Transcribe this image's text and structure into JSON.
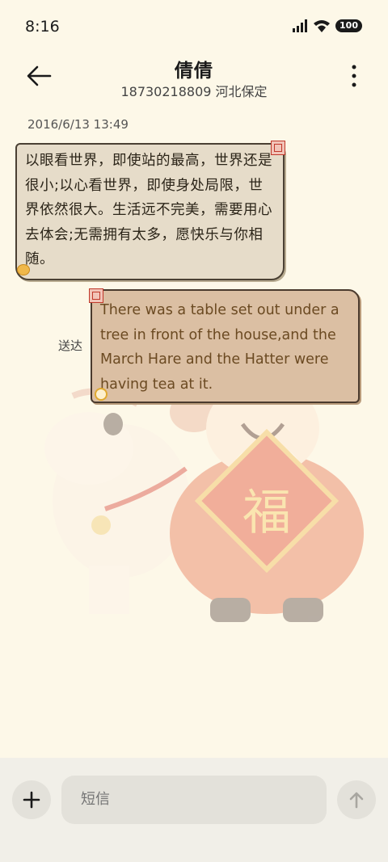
{
  "status_bar": {
    "time": "8:16",
    "battery": "100"
  },
  "header": {
    "contact_name": "倩倩",
    "contact_info": "18730218809 河北保定"
  },
  "conversation": {
    "timestamp": "2016/6/13 13:49",
    "incoming_message": "以眼看世界，即使站的最高，世界还是很小;以心看世界，即使身处局限，世界依然很大。生活远不完美，需要用心去体会;无需拥有太多，愿快乐与你相随。",
    "outgoing_message": "There was a table set out under a tree in front of the house,and the March Hare and the Hatter were having tea at it.",
    "delivery_status": "送达"
  },
  "composer": {
    "placeholder": "短信"
  },
  "icons": {
    "back": "back-arrow-icon",
    "more": "more-vertical-icon",
    "add": "plus-icon",
    "send": "send-arrow-icon"
  }
}
